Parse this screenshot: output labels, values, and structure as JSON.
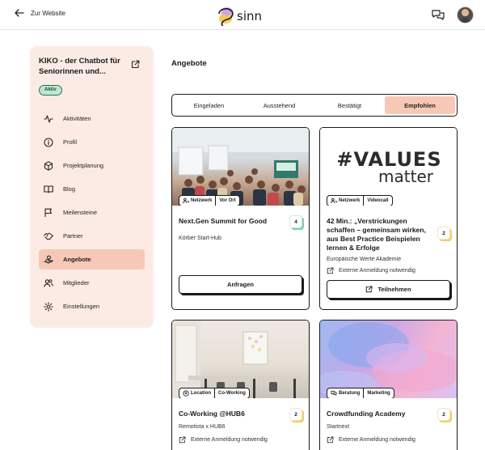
{
  "header": {
    "back_label": "Zur Website",
    "logo_text": "sinn"
  },
  "sidebar": {
    "project_title": "KIKO - der Chatbot für Seniorinnen und...",
    "status_badge": "Aktiv",
    "items": [
      {
        "label": "Aktivitäten",
        "icon": "activity-icon"
      },
      {
        "label": "Profil",
        "icon": "info-icon"
      },
      {
        "label": "Projektplanung",
        "icon": "cube-icon"
      },
      {
        "label": "Blog",
        "icon": "book-icon"
      },
      {
        "label": "Meilensteine",
        "icon": "flag-icon"
      },
      {
        "label": "Partner",
        "icon": "handshake-icon"
      },
      {
        "label": "Angebote",
        "icon": "hand-offer-icon",
        "active": true
      },
      {
        "label": "Mitglieder",
        "icon": "users-icon"
      },
      {
        "label": "Einstellungen",
        "icon": "gear-icon"
      }
    ]
  },
  "main": {
    "title": "Angebote",
    "tabs": [
      {
        "label": "Eingeladen"
      },
      {
        "label": "Ausstehend"
      },
      {
        "label": "Bestätigt"
      },
      {
        "label": "Empfohlen",
        "active": true
      }
    ],
    "cards": [
      {
        "title": "Next.Gen Summit for Good",
        "subtitle": "Körber Start-Hub",
        "score": "4",
        "chips": [
          "Netzwerk",
          "Vor Ort"
        ],
        "action": "Anfragen"
      },
      {
        "title": "42 Min.: „Verstrickungen schaffen – gemeinsam wirken, aus Best Practice Beispielen lernen & Erfolge",
        "subtitle": "Europäische Werte Akademie",
        "score": "2",
        "chips": [
          "Netzwerk",
          "Videocall"
        ],
        "note": "Externe Anmeldung notwendig",
        "action": "Teilnehmen",
        "image_text_1": "#VALUES",
        "image_text_2": "matter"
      },
      {
        "title": "Co-Working @HUB6",
        "subtitle": "Remotista x HUB6",
        "score": "2",
        "chips": [
          "Location",
          "Co-Working"
        ],
        "note": "Externe Anmeldung notwendig"
      },
      {
        "title": "Crowdfunding Academy",
        "subtitle": "Startnext",
        "score": "2",
        "chips": [
          "Beratung",
          "Marketing"
        ],
        "note": "Externe Anmeldung notwendig"
      }
    ]
  },
  "colors": {
    "accent": "#f8c8b6",
    "sidebar_bg": "#fcebe5",
    "badge_bg": "#bfe6d3",
    "score_green": "#7cd0a6",
    "score_yellow": "#f2cf63"
  }
}
